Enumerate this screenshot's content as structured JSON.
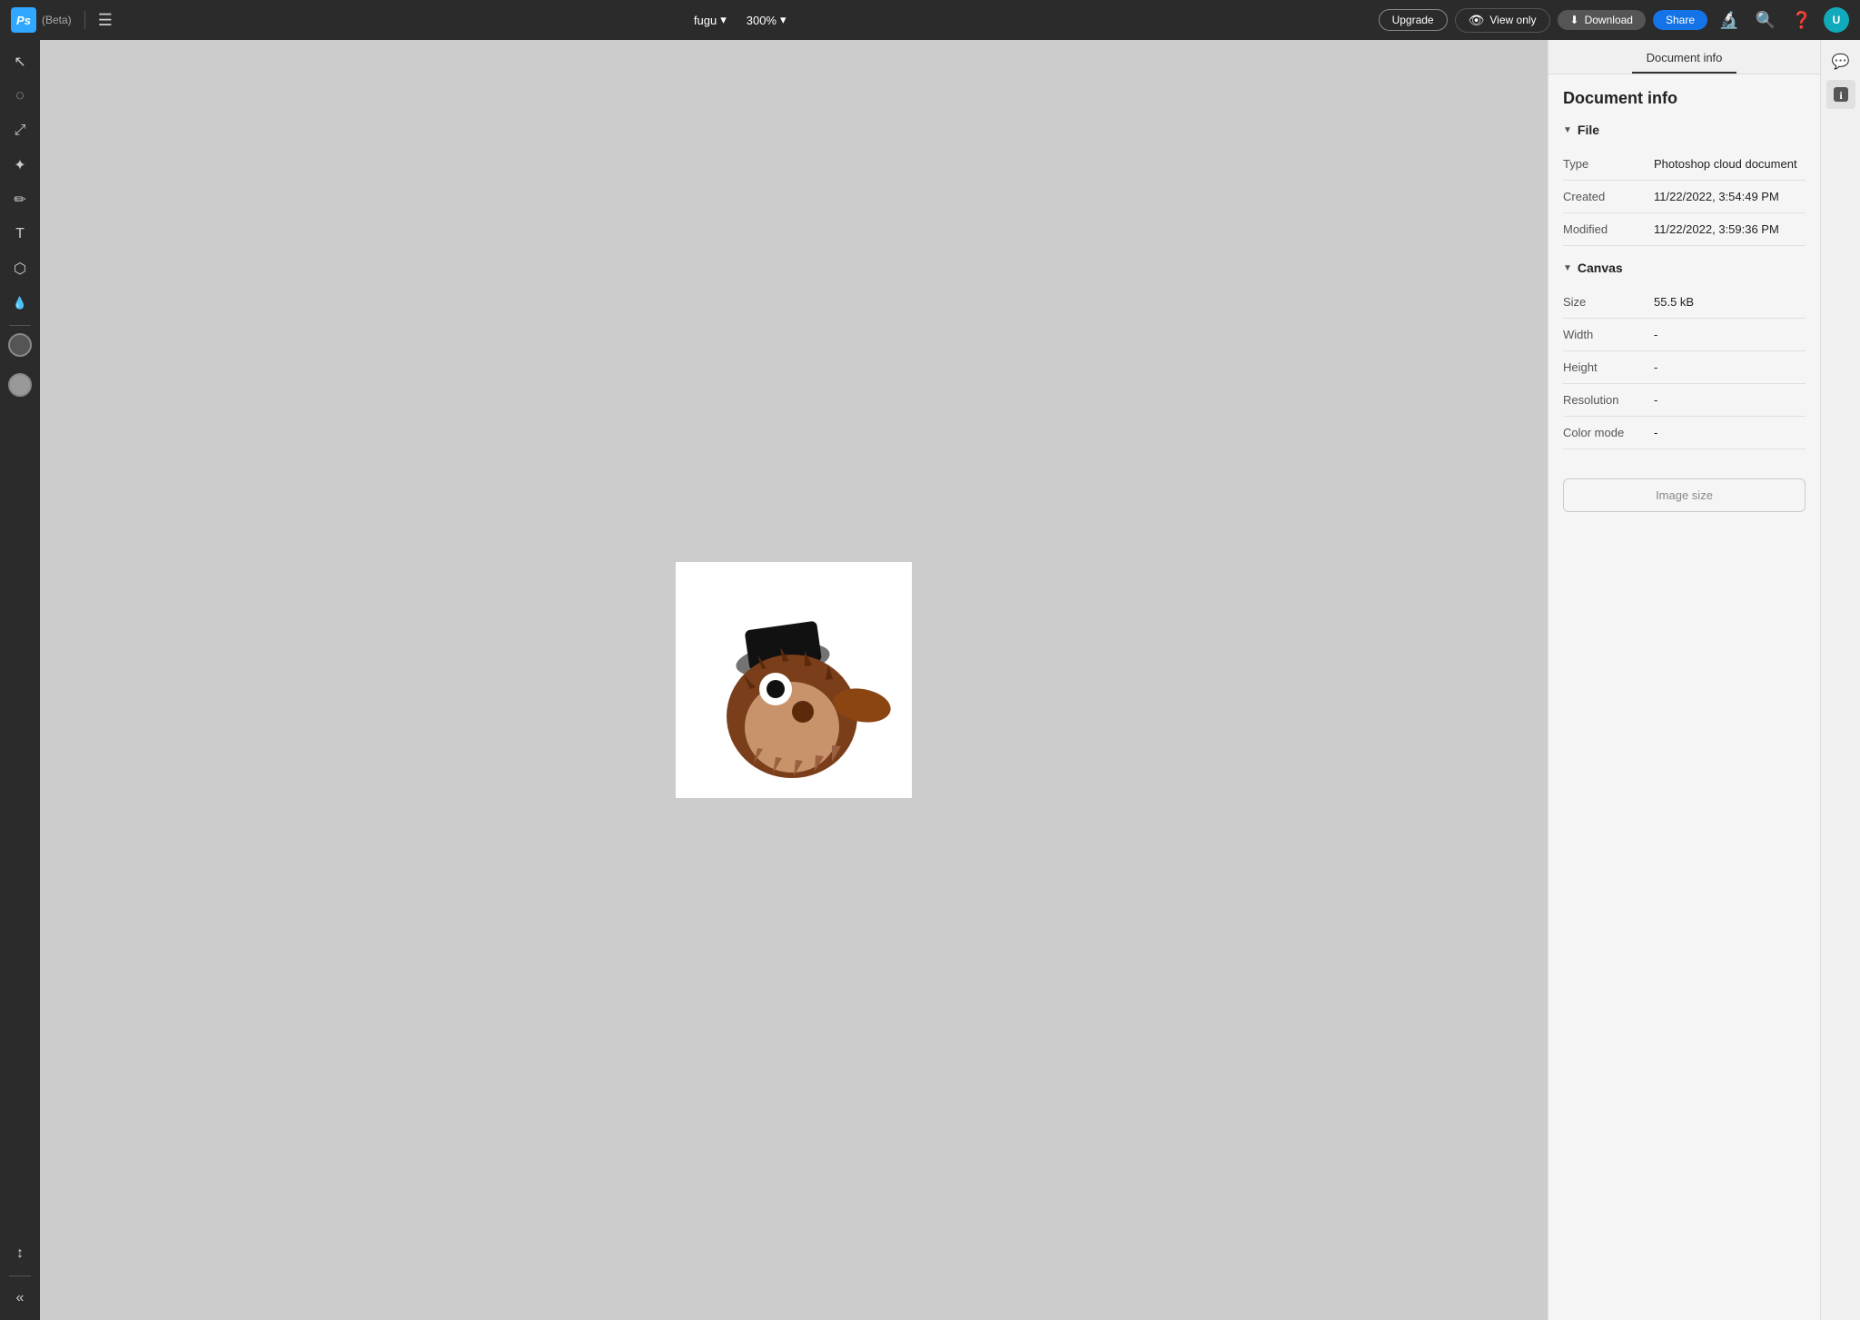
{
  "app": {
    "logo_text": "Ps",
    "beta_label": "(Beta)",
    "file_name": "fugu",
    "zoom_level": "300%",
    "upgrade_label": "Upgrade",
    "view_only_label": "View only",
    "download_label": "Download",
    "share_label": "Share"
  },
  "toolbar": {
    "tools": [
      {
        "name": "select",
        "icon": "↖",
        "label": "select-tool"
      },
      {
        "name": "lasso",
        "icon": "◌",
        "label": "lasso-tool"
      },
      {
        "name": "transform",
        "icon": "⤡",
        "label": "transform-tool"
      },
      {
        "name": "heal",
        "icon": "✦",
        "label": "heal-tool"
      },
      {
        "name": "brush",
        "icon": "✏",
        "label": "brush-tool"
      },
      {
        "name": "type",
        "icon": "T",
        "label": "type-tool"
      },
      {
        "name": "shape",
        "icon": "⬡",
        "label": "shape-tool"
      },
      {
        "name": "eyedropper",
        "icon": "🔬",
        "label": "eyedropper-tool"
      }
    ],
    "foreground_color": "#555555",
    "background_color": "#888888"
  },
  "panel": {
    "title": "Document info",
    "sections": {
      "file": {
        "label": "File",
        "rows": [
          {
            "label": "Type",
            "value": "Photoshop cloud document"
          },
          {
            "label": "Created",
            "value": "11/22/2022, 3:54:49 PM"
          },
          {
            "label": "Modified",
            "value": "11/22/2022, 3:59:36 PM"
          }
        ]
      },
      "canvas": {
        "label": "Canvas",
        "rows": [
          {
            "label": "Size",
            "value": "55.5 kB"
          },
          {
            "label": "Width",
            "value": "-"
          },
          {
            "label": "Height",
            "value": "-"
          },
          {
            "label": "Resolution",
            "value": "-"
          },
          {
            "label": "Color mode",
            "value": "-"
          }
        ]
      }
    },
    "image_size_button": "Image size"
  },
  "far_right": {
    "comment_icon": "💬",
    "info_icon": "ℹ"
  }
}
